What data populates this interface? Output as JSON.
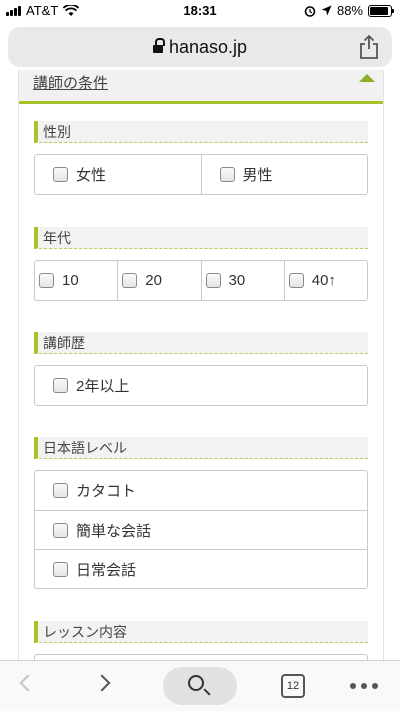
{
  "status_bar": {
    "carrier": "AT&T",
    "time": "18:31",
    "battery": "88%",
    "battery_level": 0.88
  },
  "browser": {
    "url": "hanaso.jp",
    "tab_count": "12"
  },
  "section": {
    "title": "講師の条件"
  },
  "groups": {
    "gender": {
      "title": "性別",
      "options": [
        "女性",
        "男性"
      ]
    },
    "age": {
      "title": "年代",
      "options": [
        "10",
        "20",
        "30",
        "40↑"
      ]
    },
    "experience": {
      "title": "講師歴",
      "options": [
        "2年以上"
      ]
    },
    "japanese": {
      "title": "日本語レベル",
      "options": [
        "カタコト",
        "簡単な会話",
        "日常会話"
      ]
    },
    "lesson": {
      "title": "レッスン内容"
    }
  },
  "icons": {
    "lock": "lock-icon",
    "share": "share-icon",
    "collapse": "triangle-up-icon",
    "back": "chevron-left-icon",
    "forward": "chevron-right-icon",
    "search": "search-icon",
    "more": "more-icon"
  },
  "colors": {
    "accent": "#a4c42a"
  }
}
